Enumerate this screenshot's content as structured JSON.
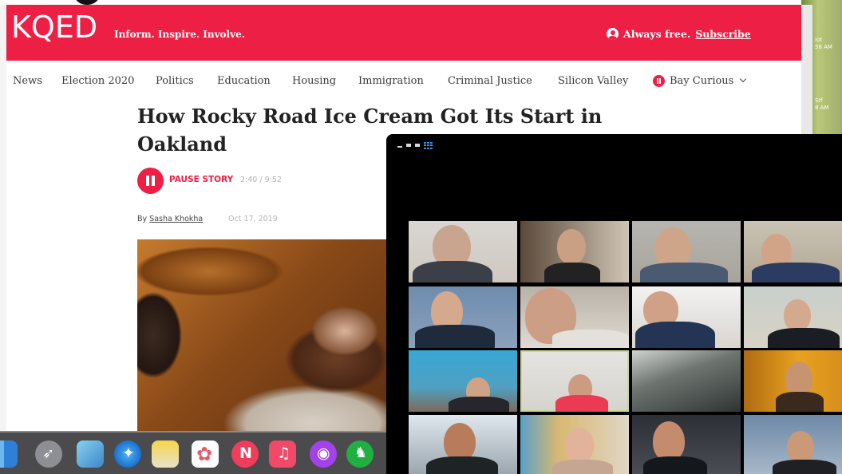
{
  "header": {
    "logo": "KQED",
    "tagline": "Inform. Inspire. Involve.",
    "always_free": "Always free.",
    "subscribe": "Subscribe"
  },
  "nav": {
    "items": [
      "News",
      "Election 2020",
      "Politics",
      "Education",
      "Housing",
      "Immigration",
      "Criminal Justice",
      "Silicon Valley",
      "Bay Curious"
    ]
  },
  "article": {
    "headline": "How Rocky Road Ice Cream Got Its Start in Oakland",
    "pause_label": "PAUSE STORY",
    "audio_time": "2:40 / 9:52",
    "byline_prefix": "By",
    "author": "Sasha Khokha",
    "date": "Oct 17, 2019"
  },
  "background_strip": {
    "line1": "iot\n58 AM",
    "line2": "Stf\n8 AM"
  },
  "zoom": {
    "view_icons": [
      "minimize-icon",
      "window-icon",
      "list-view-icon",
      "gallery-view-icon"
    ],
    "participant_count": 16,
    "active_speaker_index": 9
  },
  "dock": {
    "apps": [
      "Finder",
      "Launchpad",
      "Preview",
      "Safari",
      "TextEdit",
      "Photos",
      "News",
      "Music",
      "Podcasts",
      "Evernote"
    ]
  },
  "colors": {
    "brand_red": "#ee1f45",
    "zoom_bg": "#000000",
    "active_speaker_outline": "#c8d88a"
  }
}
